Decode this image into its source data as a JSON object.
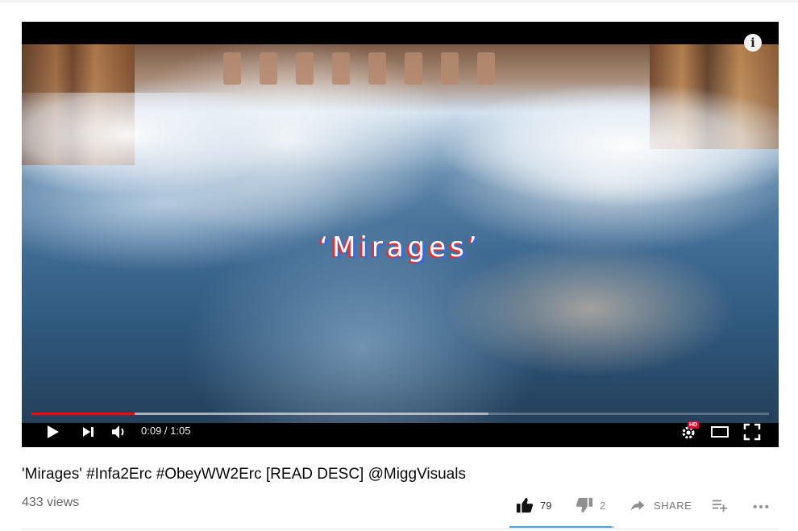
{
  "player": {
    "overlay_title": "‘Mirages’",
    "info_icon": "info-icon",
    "progress": {
      "played_fraction": 0.14,
      "buffered_fraction": 0.62
    },
    "time_display": "0:09 / 1:05",
    "hd_badge": "HD",
    "icons": [
      "play-icon",
      "next-icon",
      "volume-icon",
      "settings-icon",
      "theater-mode-icon",
      "fullscreen-icon"
    ],
    "accent_color": "#ff0000"
  },
  "video": {
    "title": "'Mirages' #Infa2Erc #ObeyWW2Erc [READ DESC] @MiggVisuals",
    "views": "433 views"
  },
  "actions": {
    "like_count": "79",
    "dislike_count": "2",
    "share_label": "SHARE",
    "sentiment_like_fraction": 0.975,
    "sentiment_color": "#3ea6ff"
  }
}
